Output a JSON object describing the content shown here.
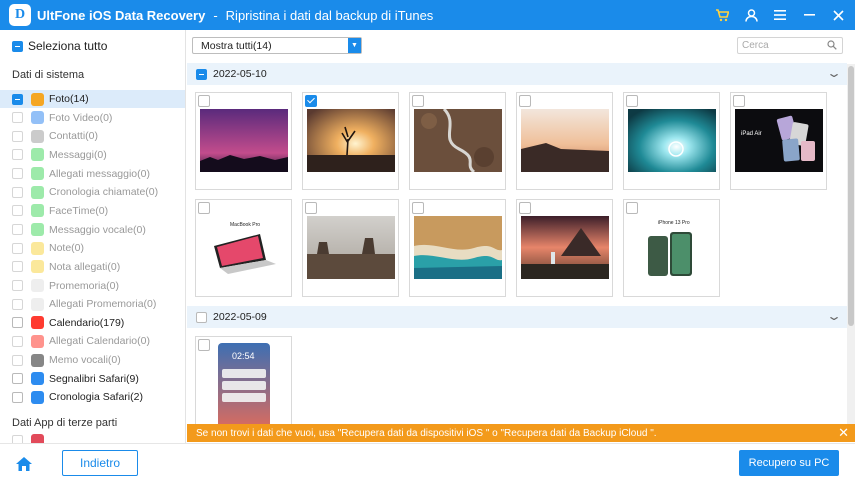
{
  "titlebar": {
    "logo_letter": "D",
    "app_title": "UltFone iOS Data Recovery",
    "separator": "-",
    "subtitle": "Ripristina i dati dal backup di iTunes",
    "icons": [
      "cart-icon",
      "user-icon",
      "menu-icon",
      "minimize-icon",
      "close-icon"
    ]
  },
  "sidebar": {
    "select_all": "Seleziona tutto",
    "section_system": "Dati di sistema",
    "items": [
      {
        "label": "Foto(14)",
        "state": "partial",
        "enabled": true,
        "icon": "photos-icon",
        "color": "#f5a623"
      },
      {
        "label": "Foto Video(0)",
        "state": "unchecked",
        "enabled": false,
        "icon": "video-icon",
        "color": "#3b8df0"
      },
      {
        "label": "Contatti(0)",
        "state": "unchecked",
        "enabled": false,
        "icon": "contacts-icon",
        "color": "#a0a0a0"
      },
      {
        "label": "Messaggi(0)",
        "state": "unchecked",
        "enabled": false,
        "icon": "messages-icon",
        "color": "#4cd964"
      },
      {
        "label": "Allegati messaggio(0)",
        "state": "unchecked",
        "enabled": false,
        "icon": "message-attachment-icon",
        "color": "#4cd964"
      },
      {
        "label": "Cronologia chiamate(0)",
        "state": "unchecked",
        "enabled": false,
        "icon": "phone-icon",
        "color": "#4cd964"
      },
      {
        "label": "FaceTime(0)",
        "state": "unchecked",
        "enabled": false,
        "icon": "facetime-icon",
        "color": "#4cd964"
      },
      {
        "label": "Messaggio vocale(0)",
        "state": "unchecked",
        "enabled": false,
        "icon": "voicemail-icon",
        "color": "#4cd964"
      },
      {
        "label": "Note(0)",
        "state": "unchecked",
        "enabled": false,
        "icon": "notes-icon",
        "color": "#f7d548"
      },
      {
        "label": "Nota allegati(0)",
        "state": "unchecked",
        "enabled": false,
        "icon": "note-attachment-icon",
        "color": "#f7d548"
      },
      {
        "label": "Promemoria(0)",
        "state": "unchecked",
        "enabled": false,
        "icon": "reminders-icon",
        "color": "#e0e0e0"
      },
      {
        "label": "Allegati Promemoria(0)",
        "state": "unchecked",
        "enabled": false,
        "icon": "reminder-attachment-icon",
        "color": "#e0e0e0"
      },
      {
        "label": "Calendario(179)",
        "state": "unchecked",
        "enabled": true,
        "icon": "calendar-icon",
        "color": "#ff3b30"
      },
      {
        "label": "Allegati Calendario(0)",
        "state": "unchecked",
        "enabled": false,
        "icon": "calendar-attachment-icon",
        "color": "#ff3b30"
      },
      {
        "label": "Memo vocali(0)",
        "state": "unchecked",
        "enabled": false,
        "icon": "voice-memo-icon",
        "color": "#222222"
      },
      {
        "label": "Segnalibri Safari(9)",
        "state": "unchecked",
        "enabled": true,
        "icon": "safari-icon",
        "color": "#2d8cf0"
      },
      {
        "label": "Cronologia Safari(2)",
        "state": "unchecked",
        "enabled": true,
        "icon": "safari-history-icon",
        "color": "#2d8cf0"
      }
    ],
    "section_third_party": "Dati App di terze parti"
  },
  "toolbar": {
    "filter_selected": "Mostra tutti(14)",
    "search_placeholder": "Cerca"
  },
  "groups": [
    {
      "date": "2022-05-10",
      "state": "partial",
      "photos": [
        {
          "name": "purple-sky-photo",
          "checked": false
        },
        {
          "name": "desert-tree-sunset-photo",
          "checked": true
        },
        {
          "name": "aerial-road-photo",
          "checked": false
        },
        {
          "name": "sunset-sea-photo",
          "checked": false
        },
        {
          "name": "light-tunnel-photo",
          "checked": false
        },
        {
          "name": "ipad-air-ad-photo",
          "checked": false
        },
        {
          "name": "macbook-pro-ad-photo",
          "checked": false
        },
        {
          "name": "monument-valley-photo",
          "checked": false
        },
        {
          "name": "beach-aerial-photo",
          "checked": false
        },
        {
          "name": "waterfall-mountain-photo",
          "checked": false
        },
        {
          "name": "iphone-13-pro-ad-photo",
          "checked": false
        }
      ]
    },
    {
      "date": "2022-05-09",
      "state": "unchecked",
      "photos": [
        {
          "name": "lockscreen-screenshot",
          "checked": false
        }
      ]
    }
  ],
  "thumb_text": {
    "ipad": "iPad Air",
    "macbook": "MacBook Pro",
    "iphone": "iPhone 13 Pro",
    "lock_time": "02:54"
  },
  "notice": {
    "text": "Se non trovi i dati che vuoi, usa \"Recupera dati da dispositivi iOS \" o \"Recupera dati da Backup iCloud \"."
  },
  "footer": {
    "back_label": "Indietro",
    "recover_label": "Recupero su PC"
  },
  "colors": {
    "accent": "#1a8bea",
    "notice": "#f39a1b",
    "selected_row": "#dcebfa"
  }
}
